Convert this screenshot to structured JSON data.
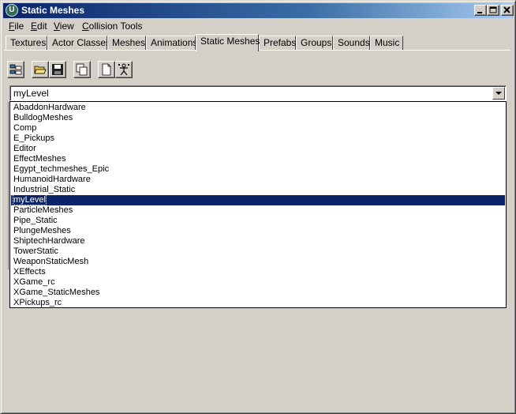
{
  "window": {
    "title": "Static Meshes",
    "app_icon_glyph": "U"
  },
  "menubar": {
    "items": [
      {
        "label": "File",
        "underline": "F",
        "rest": "ile"
      },
      {
        "label": "Edit",
        "underline": "E",
        "rest": "dit"
      },
      {
        "label": "View",
        "underline": "V",
        "rest": "iew"
      },
      {
        "label": "Collision Tools",
        "underline": "C",
        "rest": "ollision Tools"
      }
    ]
  },
  "tabs": {
    "items": [
      "Textures",
      "Actor Classes",
      "Meshes",
      "Animations",
      "Static Meshes",
      "Prefabs",
      "Groups",
      "Sounds",
      "Music"
    ],
    "active": "Static Meshes"
  },
  "toolbar": {
    "icons": [
      "browser-view-icon",
      "open-folder-icon",
      "save-icon",
      "duplicate-icon",
      "new-file-icon",
      "skeleton-icon"
    ]
  },
  "package_combo": {
    "value": "myLevel"
  },
  "package_list": {
    "items": [
      "AbaddonHardware",
      "BulldogMeshes",
      "Comp",
      "E_Pickups",
      "Editor",
      "EffectMeshes",
      "Egypt_techmeshes_Epic",
      "HumanoidHardware",
      "Industrial_Static",
      "myLevel",
      "ParticleMeshes",
      "Pipe_Static",
      "PlungeMeshes",
      "ShiptechHardware",
      "TowerStatic",
      "WeaponStaticMesh",
      "XEffects",
      "XGame_rc",
      "XGame_StaticMeshes",
      "XPickups_rc"
    ],
    "selected": "myLevel"
  },
  "colors": {
    "title_start": "#0a246a",
    "title_end": "#a6caf0",
    "selection": "#0a246a",
    "face": "#d4d0c8"
  }
}
